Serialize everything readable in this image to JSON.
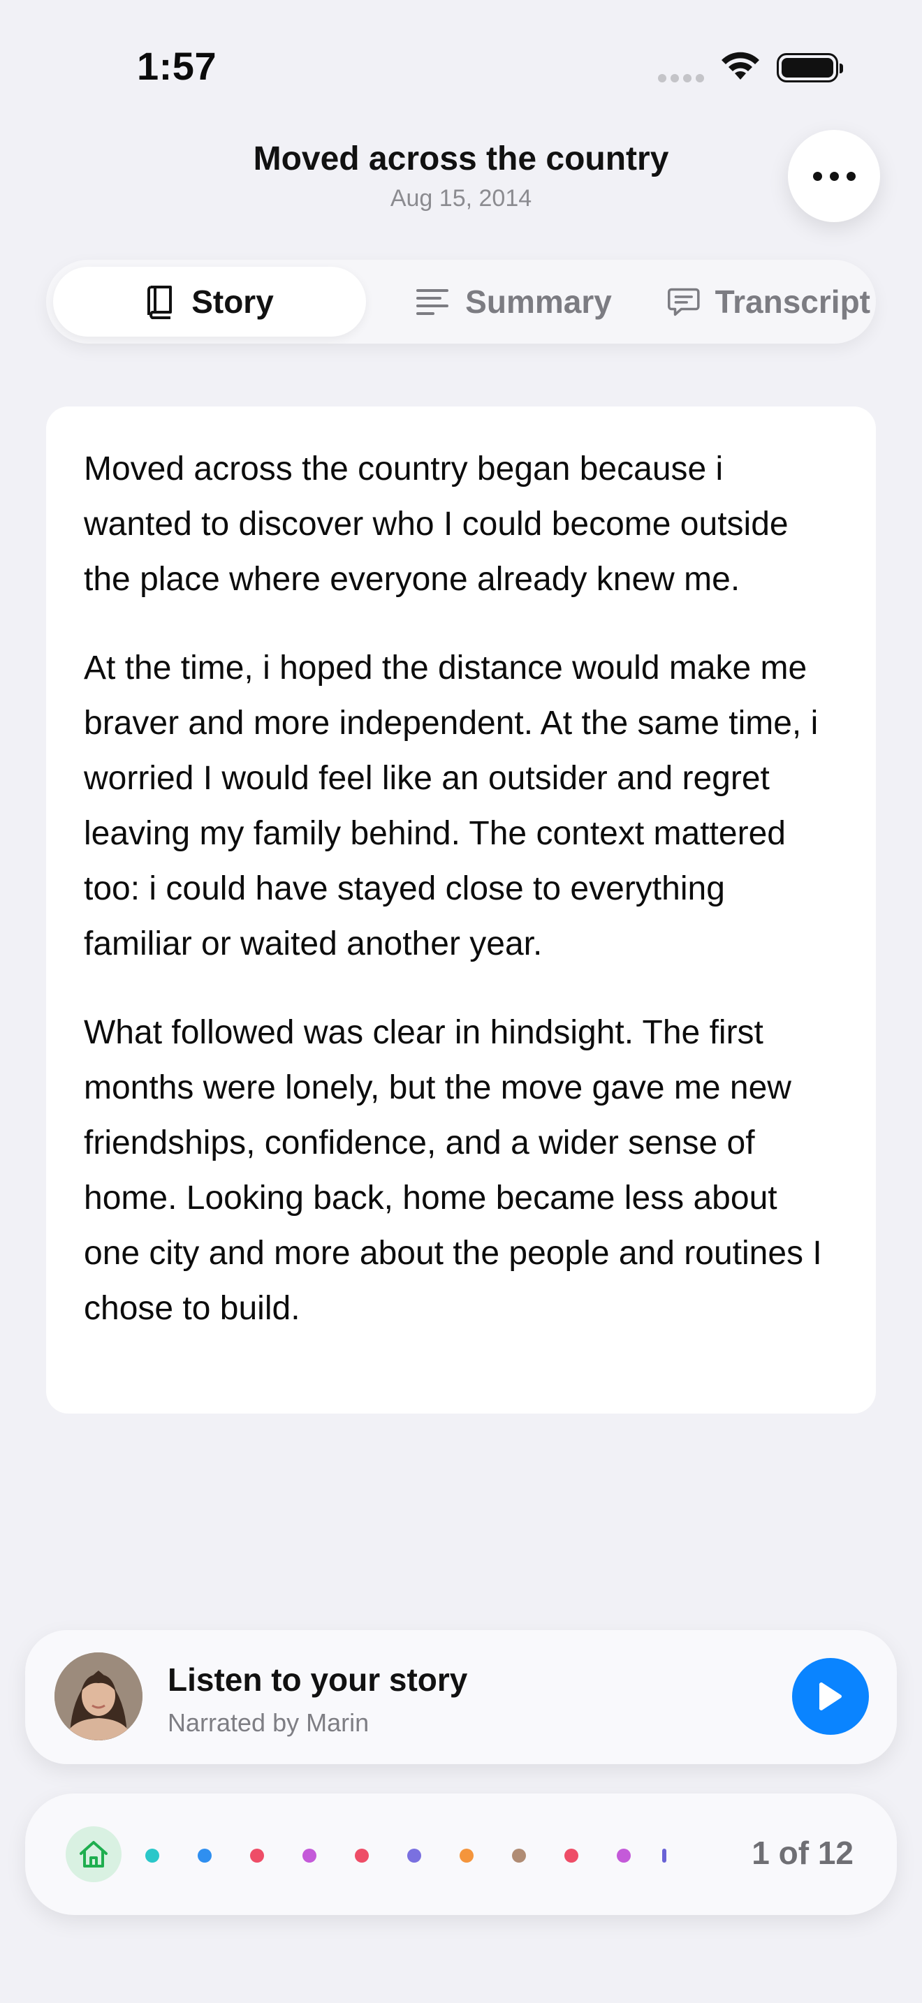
{
  "status_bar": {
    "time": "1:57"
  },
  "header": {
    "title": "Moved across the country",
    "date": "Aug 15, 2014",
    "more_icon": "more-horizontal-icon"
  },
  "tabs": [
    {
      "label": "Story",
      "icon": "book-icon",
      "active": true
    },
    {
      "label": "Summary",
      "icon": "text-lines-icon",
      "active": false
    },
    {
      "label": "Transcript",
      "icon": "chat-bubble-icon",
      "active": false
    }
  ],
  "story": {
    "paragraphs": [
      "Moved across the country began because i wanted to discover who I could become outside the place where everyone already knew me.",
      "At the time, i hoped the distance would make me braver and more independent. At the same time, i worried I would feel like an outsider and regret leaving my family behind. The context mattered too: i could have stayed close to everything familiar or waited another year.",
      "What followed was clear in hindsight. The first months were lonely, but the move gave me new friendships, confidence, and a wider sense of home. Looking back, home became less about one city and more about the people and routines I chose to build."
    ]
  },
  "player": {
    "title": "Listen to your story",
    "subtitle": "Narrated by Marin",
    "play_icon": "play-icon"
  },
  "bottom_nav": {
    "home_icon": "home-icon",
    "dot_colors": [
      "#2bc7c9",
      "#2f8ff0",
      "#ee4d67",
      "#c45ad9",
      "#ee4d67",
      "#7a70e0",
      "#f4953c",
      "#b08c74",
      "#ee4d67",
      "#c45ad9"
    ],
    "page_counter": "1 of 12"
  }
}
